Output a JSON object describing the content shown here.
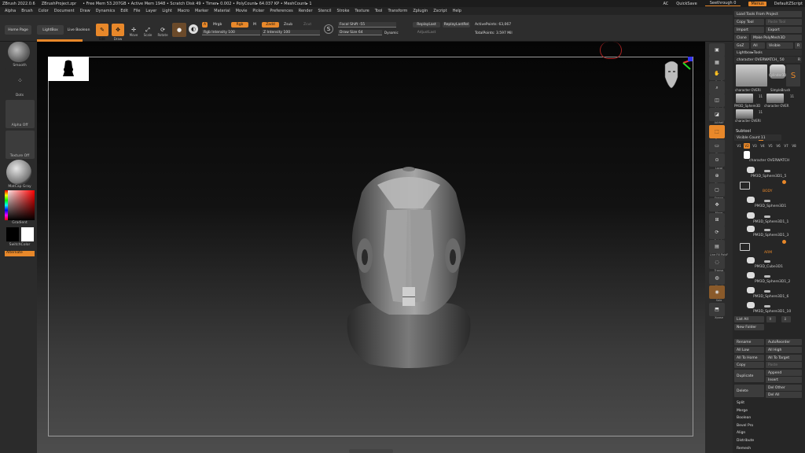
{
  "titlebar": {
    "items": [
      "ZBrush 2022.0.6",
      "ZBrushProject.zpr",
      "• Free Mem 53.207GB • Active Mem 1948 • Scratch Disk 49 • Timer▸ 0.002 • PolyCount▸ 64.037 KP • MeshCount▸ 1"
    ],
    "ac": "AC",
    "quicksave": "QuickSave",
    "search": "Seethrough 0",
    "menus": "Menus",
    "script": "DefaultZScript"
  },
  "menubar": [
    "Alpha",
    "Brush",
    "Color",
    "Document",
    "Draw",
    "Dynamics",
    "Edit",
    "File",
    "Layer",
    "Light",
    "Macro",
    "Marker",
    "Material",
    "Movie",
    "Picker",
    "Preferences",
    "Render",
    "Stencil",
    "Stroke",
    "Texture",
    "Tool",
    "Transform",
    "Zplugin",
    "Zscript",
    "Help"
  ],
  "topshelf": {
    "home": "Home Page",
    "lightbox": "LightBox",
    "livebool": "Live Boolean",
    "edit": "Edit",
    "draw": "Draw",
    "move": "Move",
    "scale": "Scale",
    "rotate": "Rotate",
    "a_label": "A",
    "mrgb": "Mrgb",
    "rgb": "Rgb",
    "m": "M",
    "zadd": "Zadd",
    "zsub": "Zsub",
    "zcut": "Zcut",
    "rgb_intensity": "Rgb Intensity 100",
    "z_intensity": "Z Intensity 100",
    "focal": "Focal Shift -55",
    "drawsize": "Draw Size 64",
    "dynamic": "Dynamic",
    "replay_last": "ReplayLast",
    "replay_last_rel": "ReplayLastRel",
    "adjust_last": "AdjustLast",
    "active_points": "ActivePoints: 63,067",
    "total_points": "TotalPoints: 3.597 Mil"
  },
  "leftshelf": {
    "brush": "Smooth",
    "stroke": "Dots",
    "alpha": "Alpha Off",
    "texture": "Texture Off",
    "material": "MatCap Gray",
    "gradient": "Gradient",
    "switchcolor": "SwitchColor",
    "alternate": "Alternate"
  },
  "rightshelf": [
    "BPR",
    "SPix 3",
    "Scroll",
    "Zoom",
    "Actual",
    "AAHalf",
    "Persp",
    "Floor",
    "Local",
    "Gizmo",
    "Frame",
    "Move",
    "Zoom3D",
    "Rotate",
    "Line Fill PolyF",
    "Transp",
    "Ghost",
    "Solo",
    "Xpose"
  ],
  "tray": {
    "load_tools": "Load Tools From Project",
    "copy_tool": "Copy Tool",
    "paste_tool": "Paste Tool",
    "import": "Import",
    "export": "Export",
    "clone": "Clone",
    "make_polymesh": "Make PolyMesh3D",
    "goz": "GoZ",
    "all": "All",
    "visible": "Visible",
    "r": "R",
    "lightbox_tools": "Lightbox▸Tools",
    "current_tool": "character OVERWATCH_ 50",
    "r2": "R",
    "tiles": [
      {
        "name": "character OVERI",
        "count": "11"
      },
      {
        "name": "Cylinder3D",
        "count": ""
      },
      {
        "name": "SimpleBrush",
        "count": ""
      },
      {
        "name": "PM3D_Sphere3D",
        "count": "11"
      },
      {
        "name": "character OVER",
        "count": "11"
      },
      {
        "name": "character OVERI",
        "count": "11"
      }
    ],
    "subtool": "Subtool",
    "visible_count": "Visible Count 11",
    "versions": [
      "V1",
      "V2",
      "V3",
      "V4",
      "V5",
      "V6",
      "V7",
      "V8"
    ],
    "subtools": [
      {
        "name": "character OVERWATCH",
        "orange": false
      },
      {
        "name": "PM3D_Sphere3D1_5",
        "orange": false
      },
      {
        "name": "BODY",
        "orange": true
      },
      {
        "name": "PM3D_Sphere3D1",
        "orange": false
      },
      {
        "name": "PM3D_Sphere3D1_1",
        "orange": false
      },
      {
        "name": "PM3D_Sphere3D1_3",
        "orange": false
      },
      {
        "name": "ARM",
        "orange": true
      },
      {
        "name": "PM3D_Cube3D1",
        "orange": false
      },
      {
        "name": "PM3D_Sphere3D1_2",
        "orange": false
      },
      {
        "name": "PM3D_Sphere3D1_6",
        "orange": false
      },
      {
        "name": "PM3D_Sphere3D1_10",
        "orange": false
      }
    ],
    "list_all": "List All",
    "new_folder": "New Folder",
    "rename": "Rename",
    "autoreorder": "AutoReorder",
    "all_low": "All Low",
    "all_high": "All High",
    "all_to_home": "All To Home",
    "all_to_target": "All To Target",
    "copy": "Copy",
    "paste": "Paste",
    "duplicate": "Duplicate",
    "append": "Append",
    "insert": "Insert",
    "delete": "Delete",
    "del_other": "Del Other",
    "del_all": "Del All",
    "split": "Split",
    "merge": "Merge",
    "boolean": "Boolean",
    "bevel_pro": "Bevel Pro",
    "align": "Align",
    "distribute": "Distribute",
    "remesh": "Remesh"
  },
  "colors": {
    "accent": "#e8882a",
    "bg": "#2a2a2a"
  }
}
